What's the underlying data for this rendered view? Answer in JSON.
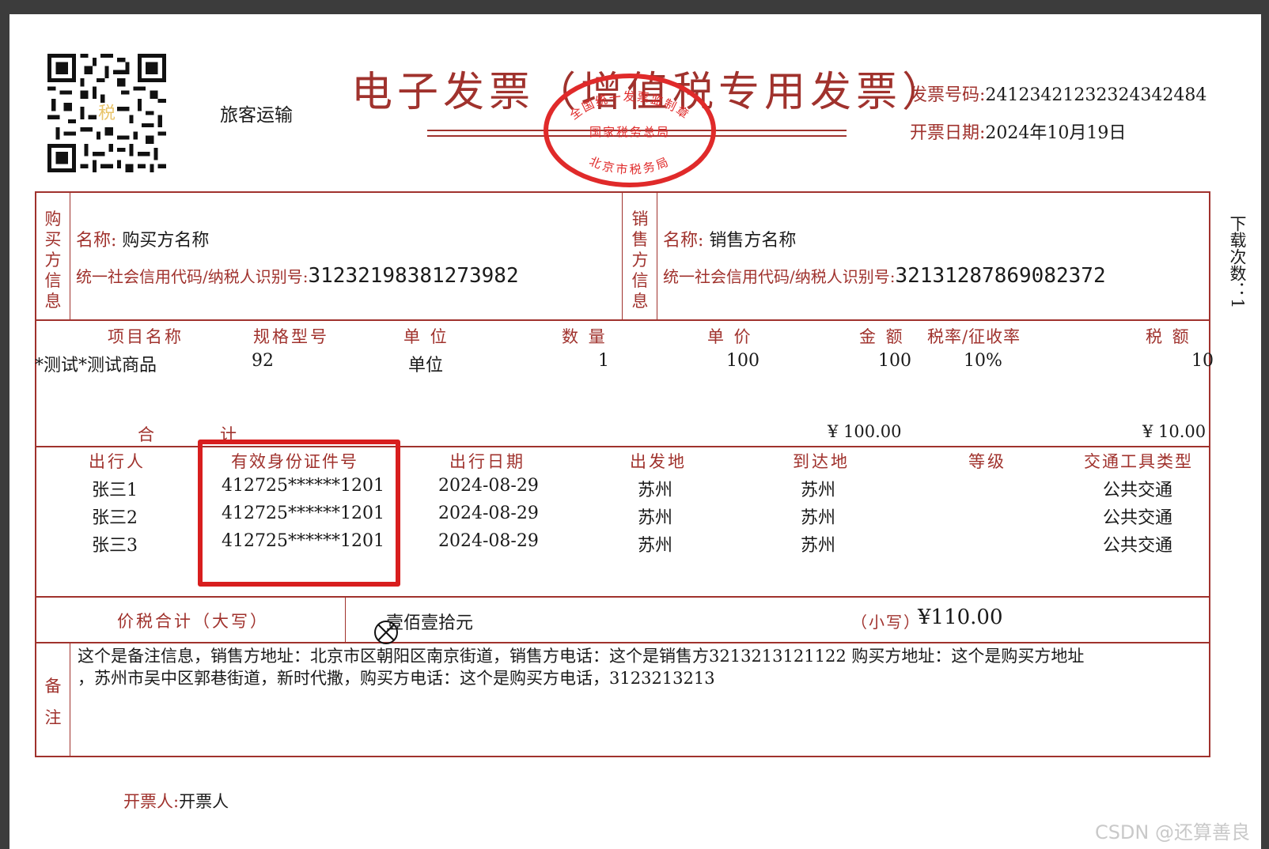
{
  "header": {
    "title": "电子发票（增值税专用发票）",
    "category": "旅客运输",
    "invoice_no_label": "发票号码:",
    "invoice_no": "24123421232324342484",
    "date_label": "开票日期:",
    "date": "2024年10月19日",
    "qr_center": "税",
    "seal": {
      "top_text": "全国统一发票监制章",
      "middle_text": "国家税务总局",
      "bottom_text": "北京市税务局",
      "color": "#e02a2a"
    }
  },
  "buyer": {
    "side_label": [
      "购",
      "买",
      "方",
      "信",
      "息"
    ],
    "name_label": "名称:",
    "name": "购买方名称",
    "tax_id_label": "统一社会信用代码/纳税人识别号:",
    "tax_id": "31232198381273982"
  },
  "seller": {
    "side_label": [
      "销",
      "售",
      "方",
      "信",
      "息"
    ],
    "name_label": "名称:",
    "name": "销售方名称",
    "tax_id_label": "统一社会信用代码/纳税人识别号:",
    "tax_id": "32131287869082372"
  },
  "download_count": "下载次数：1",
  "items": {
    "headers": [
      "项目名称",
      "规格型号",
      "单 位",
      "数 量",
      "单 价",
      "金 额",
      "税率/征收率",
      "税 额"
    ],
    "rows": [
      [
        "*测试*测试商品",
        "92",
        "单位",
        "1",
        "100",
        "100",
        "10%",
        "10"
      ]
    ],
    "total_label_1": "合",
    "total_label_2": "计",
    "total_amount": "¥ 100.00",
    "total_tax": "¥ 10.00"
  },
  "travel": {
    "headers": [
      "出行人",
      "有效身份证件号",
      "出行日期",
      "出发地",
      "到达地",
      "等级",
      "交通工具类型"
    ],
    "rows": [
      [
        "张三1",
        "412725******1201",
        "2024-08-29",
        "苏州",
        "苏州",
        "",
        "公共交通"
      ],
      [
        "张三2",
        "412725******1201",
        "2024-08-29",
        "苏州",
        "苏州",
        "",
        "公共交通"
      ],
      [
        "张三3",
        "412725******1201",
        "2024-08-29",
        "苏州",
        "苏州",
        "",
        "公共交通"
      ]
    ]
  },
  "total": {
    "label": "价税合计（大写）",
    "uppercase": "壹佰壹拾元",
    "small_label": "（小写）",
    "small_amount": "¥110.00"
  },
  "remarks": {
    "side_label": [
      "备",
      "注"
    ],
    "line1": "这个是备注信息，销售方地址：北京市区朝阳区南京街道，销售方电话：这个是销售方3213213121122 购买方地址：这个是购买方地址",
    "line2": "，苏州市吴中区郭巷街道，新时代撒，购买方电话：这个是购买方电话，3123213213"
  },
  "issuer": {
    "label": "开票人:",
    "name": "开票人"
  },
  "watermark": "CSDN @还算善良",
  "colors": {
    "invoice_red": "#a0322d",
    "highlight_red": "#d81e1e"
  }
}
